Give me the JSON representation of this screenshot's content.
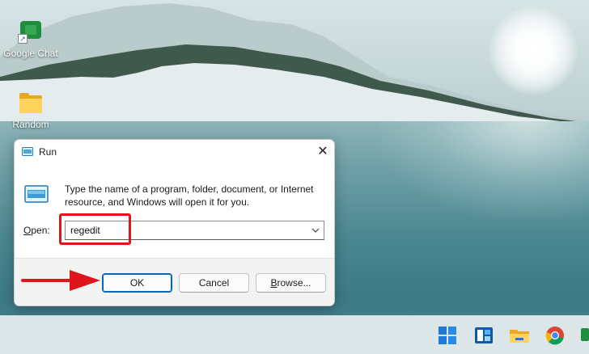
{
  "desktop": {
    "icons": [
      {
        "label": "Google Chat",
        "icon": "google-chat-icon"
      },
      {
        "label": "Random",
        "icon": "folder-icon"
      }
    ]
  },
  "run_dialog": {
    "title": "Run",
    "close_glyph": "✕",
    "instructions": "Type the name of a program, folder, document, or Internet resource, and Windows will open it for you.",
    "open_label_accel": "O",
    "open_label_rest": "pen:",
    "open_value": "regedit",
    "buttons": {
      "ok": "OK",
      "cancel": "Cancel",
      "browse_accel": "B",
      "browse_rest": "rowse..."
    }
  },
  "taskbar": {
    "items": [
      "start-icon",
      "widgets-icon",
      "file-explorer-icon",
      "chrome-icon",
      "google-chat-icon"
    ]
  },
  "colors": {
    "accent": "#0067c0",
    "annotation": "#e0151b",
    "dialog_footer": "#f3f3f3"
  }
}
